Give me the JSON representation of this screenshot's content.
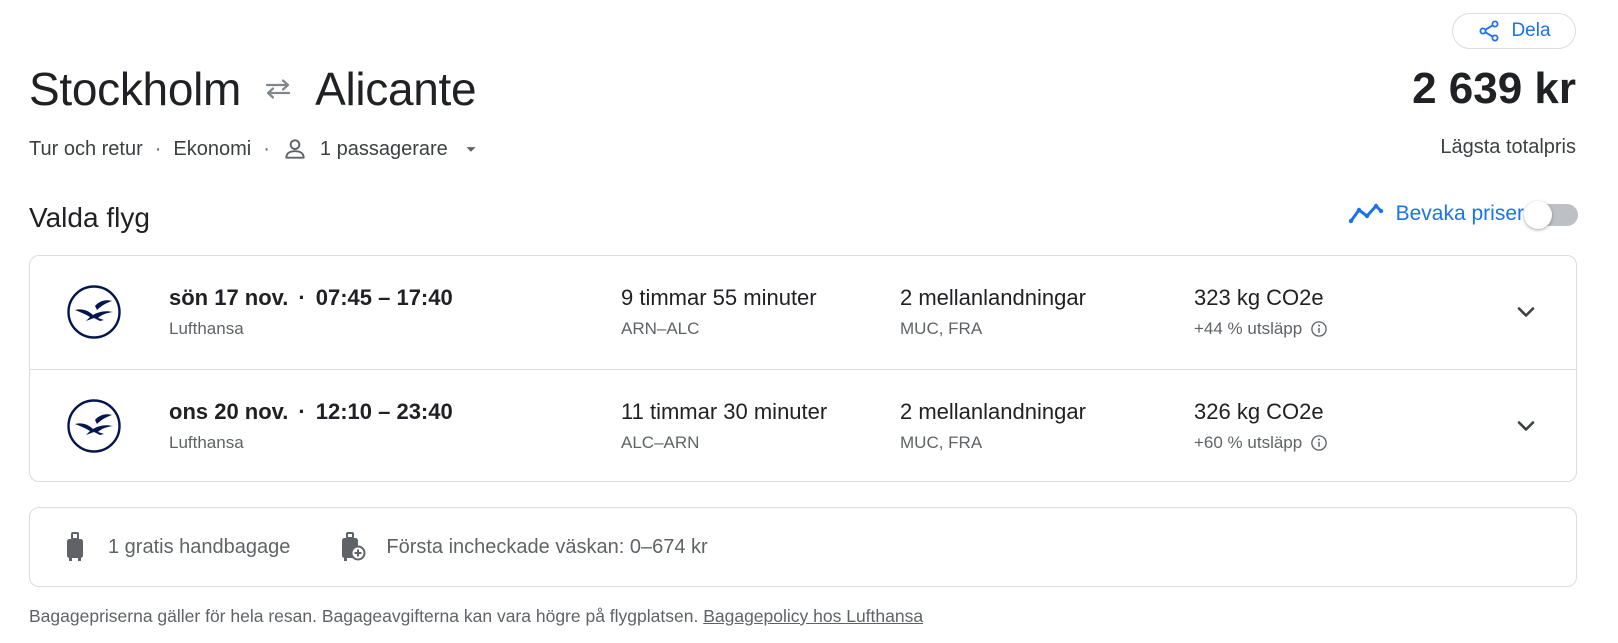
{
  "header": {
    "share_label": "Dela",
    "origin": "Stockholm",
    "destination": "Alicante",
    "price": "2 639 kr",
    "price_label": "Lägsta totalpris"
  },
  "trip": {
    "trip_type": "Tur och retur",
    "cabin_class": "Ekonomi",
    "passengers": "1 passagerare"
  },
  "section": {
    "title": "Valda flyg",
    "track_label": "Bevaka priser",
    "track_enabled": false
  },
  "flights": [
    {
      "date": "sön 17 nov.",
      "times": "07:45 – 17:40",
      "airline": "Lufthansa",
      "duration": "9 timmar 55 minuter",
      "route": "ARN–ALC",
      "stops": "2 mellanlandningar",
      "layovers": "MUC, FRA",
      "emissions": "323 kg CO2e",
      "emissions_delta": "+44 % utsläpp"
    },
    {
      "date": "ons 20 nov.",
      "times": "12:10 – 23:40",
      "airline": "Lufthansa",
      "duration": "11 timmar 30 minuter",
      "route": "ALC–ARN",
      "stops": "2 mellanlandningar",
      "layovers": "MUC, FRA",
      "emissions": "326 kg CO2e",
      "emissions_delta": "+60 % utsläpp"
    }
  ],
  "baggage": {
    "carry_on": "1 gratis handbagage",
    "checked": "Första incheckade väskan: 0–674 kr"
  },
  "footnote": {
    "text": "Bagagepriserna gäller för hela resan. Bagageavgifterna kan vara högre på flygplatsen.",
    "link": "Bagagepolicy hos Lufthansa"
  },
  "icons": {
    "share": "share-icon",
    "swap": "swap-arrows-icon",
    "person": "person-icon",
    "caret": "caret-down-icon",
    "trend": "trending-line-icon",
    "info": "info-icon",
    "airline": "lufthansa-crane-logo",
    "expand": "chevron-down-icon",
    "carry_on": "carry-on-bag-icon",
    "checked": "checked-bag-icon"
  },
  "colors": {
    "accent": "#1a73e8",
    "text_primary": "#202124",
    "text_secondary": "#5f6368",
    "border": "#dadce0",
    "airline_navy": "#05164d"
  }
}
